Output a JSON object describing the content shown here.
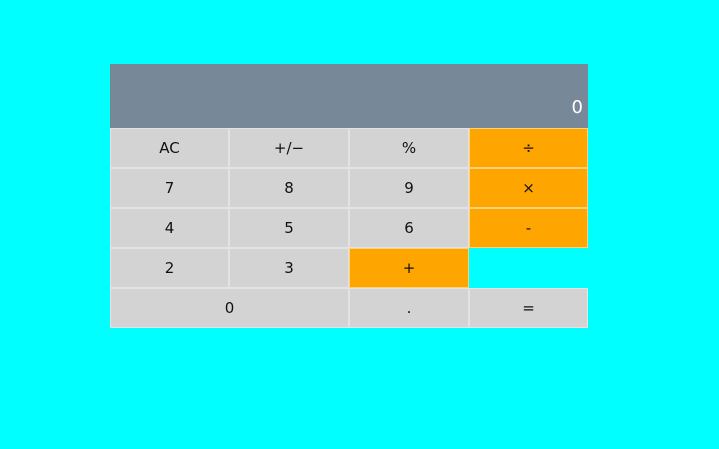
{
  "display": {
    "value": "0"
  },
  "keys": {
    "ac": "AC",
    "plus_minus": "+/−",
    "percent": "%",
    "divide": "÷",
    "seven": "7",
    "eight": "8",
    "nine": "9",
    "multiply": "×",
    "four": "4",
    "five": "5",
    "six": "6",
    "minus": "-",
    "two": "2",
    "three": "3",
    "plus": "+",
    "zero": "0",
    "decimal": ".",
    "equals": "="
  },
  "colors": {
    "background": "#00ffff",
    "display_background": "#778899",
    "key_background": "#d3d3d3",
    "operator_background": "#ffa500"
  }
}
